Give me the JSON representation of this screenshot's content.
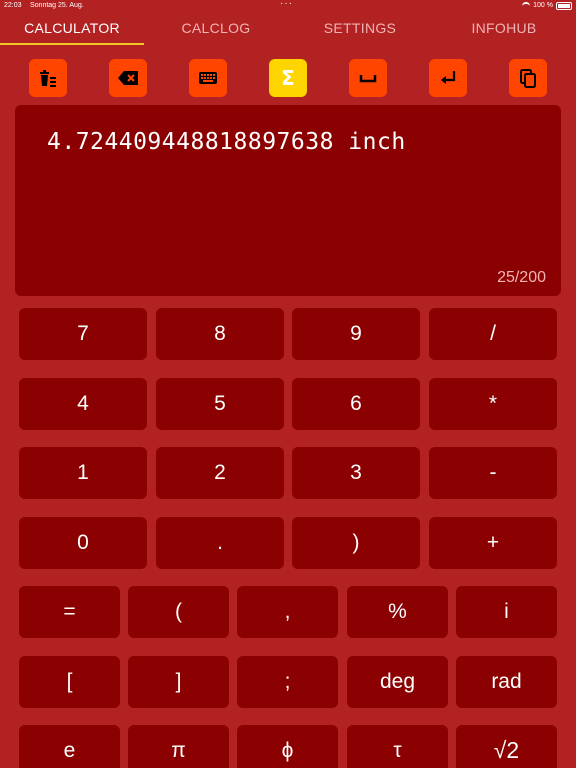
{
  "status_bar": {
    "time": "22:03",
    "date": "Sonntag 25. Aug.",
    "battery": "100 %"
  },
  "tabs": [
    {
      "label": "CALCULATOR",
      "active": true
    },
    {
      "label": "CALCLOG",
      "active": false
    },
    {
      "label": "SETTINGS",
      "active": false
    },
    {
      "label": "INFOHUB",
      "active": false
    }
  ],
  "toolbar": [
    {
      "icon": "clear-all-icon",
      "name": "clear-all-button",
      "color": "#ff4500"
    },
    {
      "icon": "backspace-icon",
      "name": "backspace-button",
      "color": "#ff4500"
    },
    {
      "icon": "keyboard-icon",
      "name": "keyboard-button",
      "color": "#ff4500"
    },
    {
      "icon": "sigma-icon",
      "name": "sigma-button",
      "color": "#ffd500"
    },
    {
      "icon": "space-icon",
      "name": "space-button",
      "color": "#ff4500"
    },
    {
      "icon": "return-icon",
      "name": "return-button",
      "color": "#ff4500"
    },
    {
      "icon": "copy-icon",
      "name": "copy-button",
      "color": "#ff4500"
    }
  ],
  "display": {
    "expression": "4.724409448818897638 inch",
    "counter": "25/200"
  },
  "keypad": {
    "rows_4": [
      [
        "7",
        "8",
        "9",
        "/"
      ],
      [
        "4",
        "5",
        "6",
        "*"
      ],
      [
        "1",
        "2",
        "3",
        "-"
      ],
      [
        "0",
        ".",
        ")",
        "+"
      ]
    ],
    "rows_5": [
      [
        "=",
        "(",
        ",",
        "%",
        "i"
      ],
      [
        "[",
        "]",
        ";",
        "deg",
        "rad"
      ],
      [
        "e",
        "π",
        "ϕ",
        "τ",
        "√2"
      ]
    ]
  },
  "colors": {
    "background": "#b22222",
    "panel": "#8b0000",
    "toolbar_button": "#ff4500",
    "toolbar_active": "#ffd500",
    "tab_underline": "#f3c624"
  }
}
